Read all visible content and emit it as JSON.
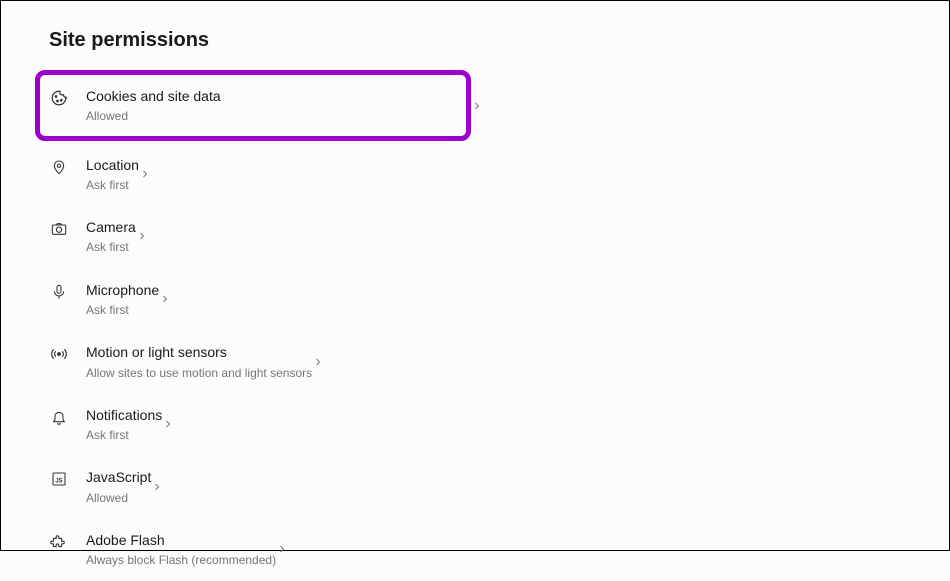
{
  "page": {
    "title": "Site permissions"
  },
  "permissions": [
    {
      "title": "Cookies and site data",
      "subtitle": "Allowed",
      "highlighted": true
    },
    {
      "title": "Location",
      "subtitle": "Ask first",
      "highlighted": false
    },
    {
      "title": "Camera",
      "subtitle": "Ask first",
      "highlighted": false
    },
    {
      "title": "Microphone",
      "subtitle": "Ask first",
      "highlighted": false
    },
    {
      "title": "Motion or light sensors",
      "subtitle": "Allow sites to use motion and light sensors",
      "highlighted": false
    },
    {
      "title": "Notifications",
      "subtitle": "Ask first",
      "highlighted": false
    },
    {
      "title": "JavaScript",
      "subtitle": "Allowed",
      "highlighted": false
    },
    {
      "title": "Adobe Flash",
      "subtitle": "Always block Flash (recommended)",
      "highlighted": false
    }
  ]
}
